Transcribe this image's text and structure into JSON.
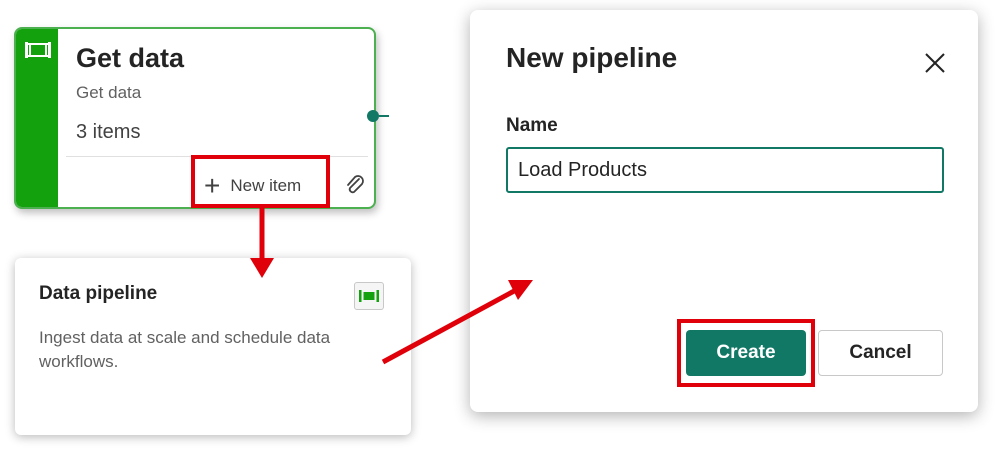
{
  "get_data_card": {
    "title": "Get data",
    "subtitle": "Get data",
    "count": "3 items",
    "new_item_label": "New item",
    "icon": "pipeline-icon"
  },
  "pipeline_card": {
    "title": "Data pipeline",
    "description": "Ingest data at scale and schedule data workflows.",
    "icon": "pipeline-icon"
  },
  "dialog": {
    "title": "New pipeline",
    "name_label": "Name",
    "name_value": "Load Products",
    "create_label": "Create",
    "cancel_label": "Cancel"
  },
  "colors": {
    "accent": "#117865",
    "card_bar": "#13a10e",
    "highlight": "#e0000a"
  }
}
